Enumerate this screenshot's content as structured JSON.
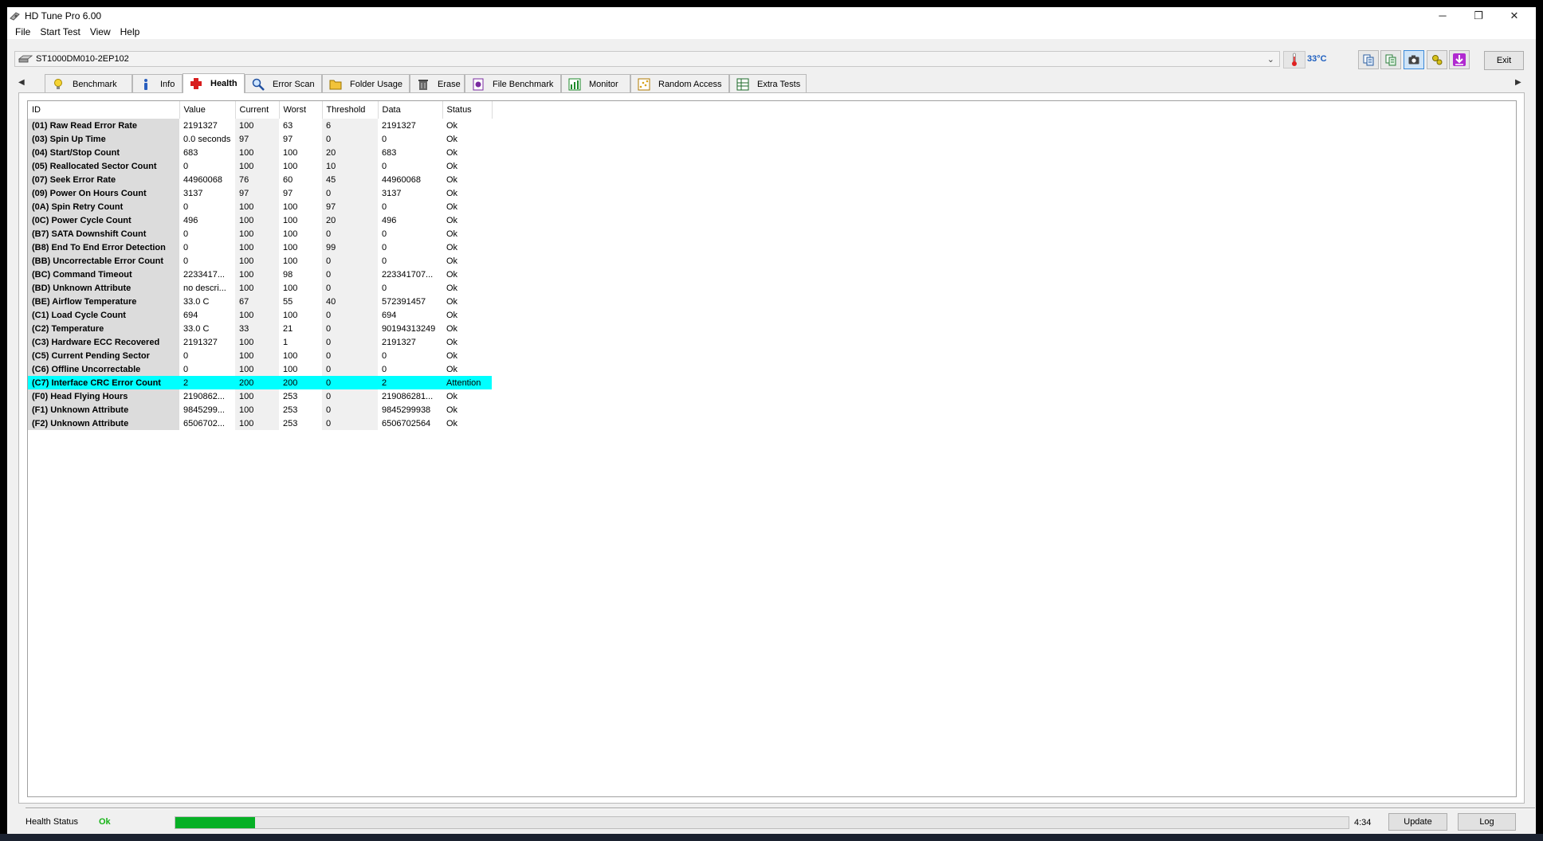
{
  "window": {
    "title": "HD Tune Pro 6.00",
    "controls": {
      "minimize": "─",
      "restore": "❐",
      "close": "✕"
    }
  },
  "menu": [
    "File",
    "Start Test",
    "View",
    "Help"
  ],
  "drive": {
    "selected": "ST1000DM010-2EP102",
    "temperature": "33°C"
  },
  "toolbar": {
    "buttons": [
      "copy-info-icon",
      "copy-text-icon",
      "screenshot-icon",
      "options-icon",
      "save-icon"
    ],
    "active_index": 2,
    "exit_label": "Exit"
  },
  "tabs": [
    {
      "label": "Benchmark",
      "icon": "lightbulb-icon"
    },
    {
      "label": "Info",
      "icon": "info-icon"
    },
    {
      "label": "Health",
      "icon": "health-cross-icon"
    },
    {
      "label": "Error Scan",
      "icon": "magnifier-icon"
    },
    {
      "label": "Folder Usage",
      "icon": "folder-icon"
    },
    {
      "label": "Erase",
      "icon": "trash-icon"
    },
    {
      "label": "File Benchmark",
      "icon": "file-benchmark-icon"
    },
    {
      "label": "Monitor",
      "icon": "monitor-chart-icon"
    },
    {
      "label": "Random Access",
      "icon": "random-access-icon"
    },
    {
      "label": "Extra Tests",
      "icon": "extra-tests-icon"
    }
  ],
  "active_tab": "Health",
  "smart": {
    "columns": [
      "ID",
      "Value",
      "Current",
      "Worst",
      "Threshold",
      "Data",
      "Status"
    ],
    "rows": [
      [
        "(01) Raw Read Error Rate",
        "2191327",
        "100",
        "63",
        "6",
        "2191327",
        "Ok"
      ],
      [
        "(03) Spin Up Time",
        "0.0 seconds",
        "97",
        "97",
        "0",
        "0",
        "Ok"
      ],
      [
        "(04) Start/Stop Count",
        "683",
        "100",
        "100",
        "20",
        "683",
        "Ok"
      ],
      [
        "(05) Reallocated Sector Count",
        "0",
        "100",
        "100",
        "10",
        "0",
        "Ok"
      ],
      [
        "(07) Seek Error Rate",
        "44960068",
        "76",
        "60",
        "45",
        "44960068",
        "Ok"
      ],
      [
        "(09) Power On Hours Count",
        "3137",
        "97",
        "97",
        "0",
        "3137",
        "Ok"
      ],
      [
        "(0A) Spin Retry Count",
        "0",
        "100",
        "100",
        "97",
        "0",
        "Ok"
      ],
      [
        "(0C) Power Cycle Count",
        "496",
        "100",
        "100",
        "20",
        "496",
        "Ok"
      ],
      [
        "(B7) SATA Downshift Count",
        "0",
        "100",
        "100",
        "0",
        "0",
        "Ok"
      ],
      [
        "(B8) End To End Error Detection",
        "0",
        "100",
        "100",
        "99",
        "0",
        "Ok"
      ],
      [
        "(BB) Uncorrectable Error Count",
        "0",
        "100",
        "100",
        "0",
        "0",
        "Ok"
      ],
      [
        "(BC) Command Timeout",
        "2233417...",
        "100",
        "98",
        "0",
        "223341707...",
        "Ok"
      ],
      [
        "(BD) Unknown Attribute",
        "no descri...",
        "100",
        "100",
        "0",
        "0",
        "Ok"
      ],
      [
        "(BE) Airflow Temperature",
        "33.0 C",
        "67",
        "55",
        "40",
        "572391457",
        "Ok"
      ],
      [
        "(C1) Load Cycle Count",
        "694",
        "100",
        "100",
        "0",
        "694",
        "Ok"
      ],
      [
        "(C2) Temperature",
        "33.0 C",
        "33",
        "21",
        "0",
        "90194313249",
        "Ok"
      ],
      [
        "(C3) Hardware ECC Recovered",
        "2191327",
        "100",
        "1",
        "0",
        "2191327",
        "Ok"
      ],
      [
        "(C5) Current Pending Sector",
        "0",
        "100",
        "100",
        "0",
        "0",
        "Ok"
      ],
      [
        "(C6) Offline Uncorrectable",
        "0",
        "100",
        "100",
        "0",
        "0",
        "Ok"
      ],
      [
        "(C7) Interface CRC Error Count",
        "2",
        "200",
        "200",
        "0",
        "2",
        "Attention"
      ],
      [
        "(F0) Head Flying Hours",
        "2190862...",
        "100",
        "253",
        "0",
        "219086281...",
        "Ok"
      ],
      [
        "(F1) Unknown Attribute",
        "9845299...",
        "100",
        "253",
        "0",
        "9845299938",
        "Ok"
      ],
      [
        "(F2) Unknown Attribute",
        "6506702...",
        "100",
        "253",
        "0",
        "6506702564",
        "Ok"
      ]
    ],
    "highlight_color": "#00ffff"
  },
  "status": {
    "label": "Health Status",
    "value": "Ok",
    "value_color": "#18b418",
    "progress_fraction": 0.068,
    "time": "4:34",
    "update_label": "Update",
    "log_label": "Log"
  }
}
